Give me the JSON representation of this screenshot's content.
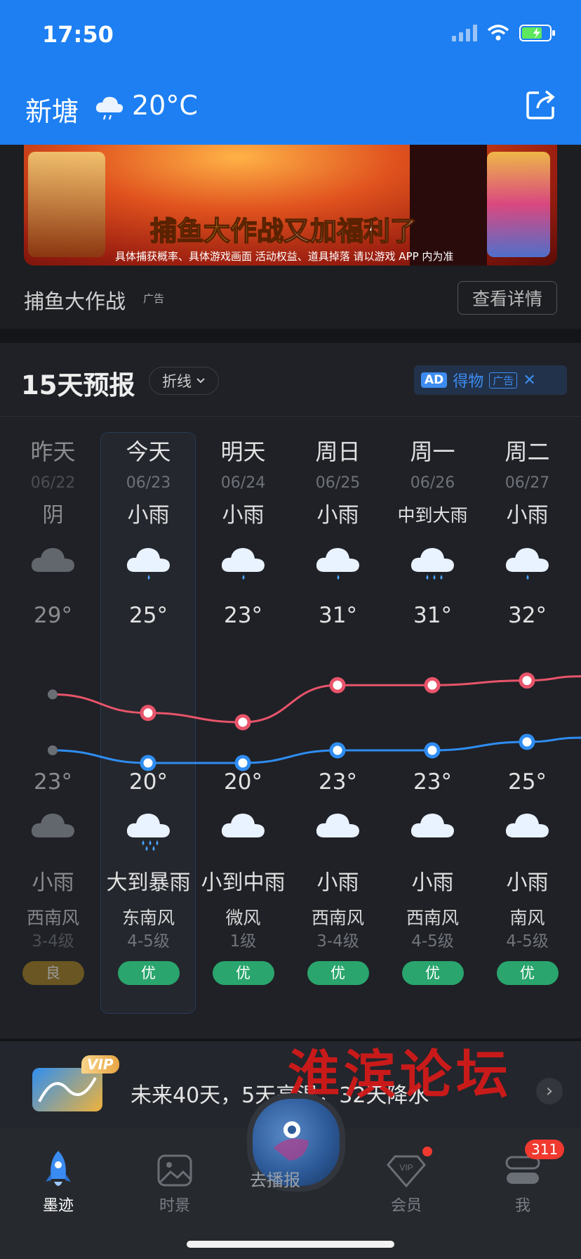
{
  "status_bar": {
    "time": "17:50"
  },
  "header": {
    "city": "新塘",
    "current_temp": "20°C"
  },
  "ad": {
    "headline_yellow": "捕鱼大作战",
    "headline_white": "又加福利了",
    "fine_print": "具体捕获概率、具体游戏画面 活动权益、道具掉落 请以游戏 APP 内为准",
    "title": "捕鱼大作战",
    "tag": "广告",
    "detail_button": "查看详情"
  },
  "forecast": {
    "title": "15天预报",
    "mode": "折线",
    "sponsor": {
      "badge": "AD",
      "name": "得物",
      "tag": "广告",
      "close": "✕"
    },
    "days": [
      {
        "name": "昨天",
        "date": "06/22",
        "day_cond": "阴",
        "high": "29°",
        "low": "23°",
        "night_cond": "小雨",
        "wind_dir": "西南风",
        "wind_level": "3-4级",
        "aqi": "良"
      },
      {
        "name": "今天",
        "date": "06/23",
        "day_cond": "小雨",
        "high": "25°",
        "low": "20°",
        "night_cond": "大到暴雨",
        "wind_dir": "东南风",
        "wind_level": "4-5级",
        "aqi": "优"
      },
      {
        "name": "明天",
        "date": "06/24",
        "day_cond": "小雨",
        "high": "23°",
        "low": "20°",
        "night_cond": "小到中雨",
        "wind_dir": "微风",
        "wind_level": "1级",
        "aqi": "优"
      },
      {
        "name": "周日",
        "date": "06/25",
        "day_cond": "小雨",
        "high": "31°",
        "low": "23°",
        "night_cond": "小雨",
        "wind_dir": "西南风",
        "wind_level": "3-4级",
        "aqi": "优"
      },
      {
        "name": "周一",
        "date": "06/26",
        "day_cond": "中到大雨",
        "high": "31°",
        "low": "23°",
        "night_cond": "小雨",
        "wind_dir": "西南风",
        "wind_level": "4-5级",
        "aqi": "优"
      },
      {
        "name": "周二",
        "date": "06/27",
        "day_cond": "小雨",
        "high": "32°",
        "low": "25°",
        "night_cond": "小雨",
        "wind_dir": "南风",
        "wind_level": "4-5级",
        "aqi": "优"
      }
    ]
  },
  "chart_data": {
    "type": "line",
    "categories": [
      "06/22",
      "06/23",
      "06/24",
      "06/25",
      "06/26",
      "06/27"
    ],
    "series": [
      {
        "values": [
          29,
          25,
          23,
          31,
          31,
          32
        ],
        "color": "#e8546a"
      },
      {
        "values": [
          23,
          20,
          20,
          23,
          23,
          25
        ],
        "color": "#2f8df2"
      }
    ]
  },
  "promo": {
    "vip": "VIP",
    "text": "未来40天，5天高温，32天降水"
  },
  "watermark": "淮滨论坛",
  "tabbar": {
    "tabs": [
      "墨迹",
      "时景",
      "会员",
      "我"
    ],
    "center_label": "去播报",
    "badge": "311"
  }
}
